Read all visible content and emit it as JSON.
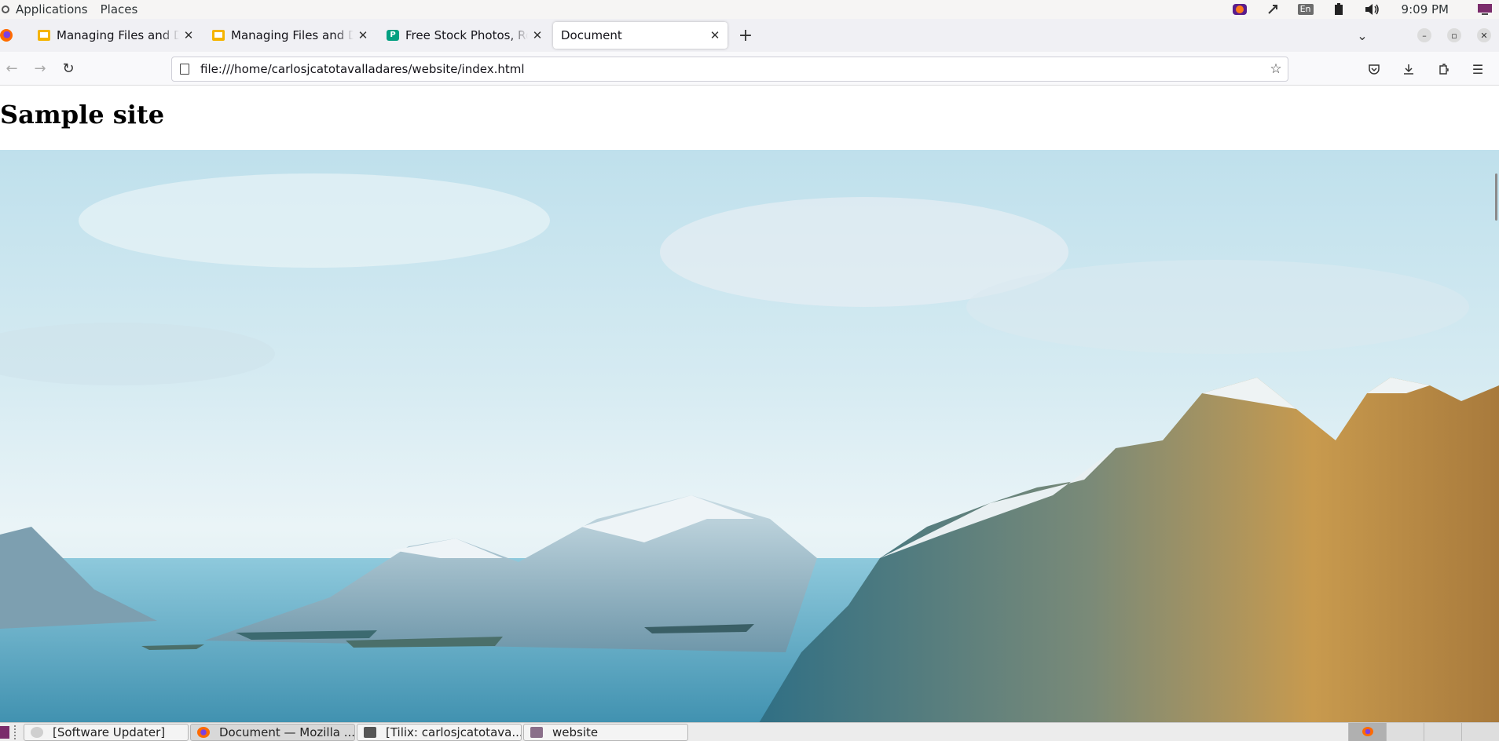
{
  "top_panel": {
    "menu": [
      "Applications",
      "Places"
    ],
    "tray_icons": [
      "firefox-tray-icon",
      "network-icon",
      "keyboard-layout-indicator",
      "battery-icon",
      "volume-icon"
    ],
    "keyboard_layout": "En",
    "clock": "9:09 PM"
  },
  "browser": {
    "tabs": [
      {
        "title": "Managing Files and Directories",
        "favicon": "slides-icon",
        "active": false
      },
      {
        "title": "Managing Files and Directories",
        "favicon": "slides-icon",
        "active": false
      },
      {
        "title": "Free Stock Photos, Royalty Free",
        "favicon": "pexels-icon",
        "active": false
      },
      {
        "title": "Document",
        "favicon": "none",
        "active": true
      }
    ],
    "url": "file:///home/carlosjcatotavalladares/website/index.html"
  },
  "page": {
    "heading": "Sample site",
    "hero_image": "mountain-landscape-image"
  },
  "taskbar": {
    "tasks": [
      {
        "label": "[Software Updater]",
        "active": false
      },
      {
        "label": "Document — Mozilla ...",
        "active": true
      },
      {
        "label": "[Tilix: carlosjcatotava...",
        "active": false
      },
      {
        "label": "website",
        "active": false
      }
    ]
  },
  "colors": {
    "chrome_bg": "#f0f0f4",
    "active_tab": "#ffffff",
    "sky_top": "#bfe0ec",
    "water": "#6fb6cf"
  }
}
